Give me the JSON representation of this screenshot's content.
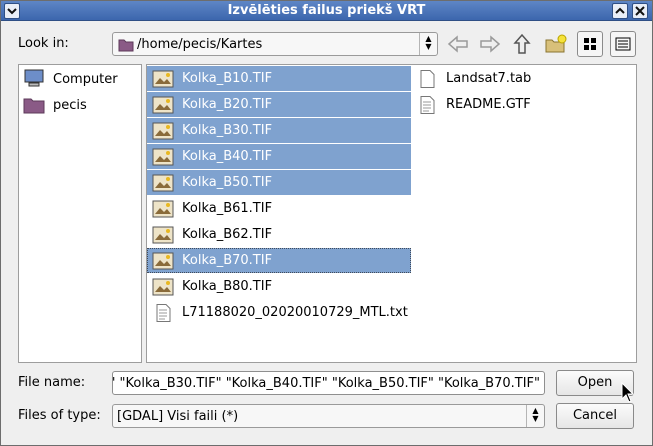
{
  "window": {
    "title": "Izvēlēties failus priekš VRT"
  },
  "toolbar": {
    "look_in_label": "Look in:",
    "current_path": "/home/pecis/Kartes"
  },
  "sidebar": {
    "items": [
      {
        "label": "Computer",
        "icon": "computer-icon"
      },
      {
        "label": "pecis",
        "icon": "folder-icon"
      }
    ]
  },
  "files": {
    "items": [
      {
        "name": "Kolka_B10.TIF",
        "icon": "image-file-icon",
        "selected": true
      },
      {
        "name": "Kolka_B20.TIF",
        "icon": "image-file-icon",
        "selected": true
      },
      {
        "name": "Kolka_B30.TIF",
        "icon": "image-file-icon",
        "selected": true
      },
      {
        "name": "Kolka_B40.TIF",
        "icon": "image-file-icon",
        "selected": true
      },
      {
        "name": "Kolka_B50.TIF",
        "icon": "image-file-icon",
        "selected": true
      },
      {
        "name": "Kolka_B61.TIF",
        "icon": "image-file-icon",
        "selected": false
      },
      {
        "name": "Kolka_B62.TIF",
        "icon": "image-file-icon",
        "selected": false
      },
      {
        "name": "Kolka_B70.TIF",
        "icon": "image-file-icon",
        "selected": true
      },
      {
        "name": "Kolka_B80.TIF",
        "icon": "image-file-icon",
        "selected": false
      },
      {
        "name": "L71188020_02020010729_MTL.txt",
        "icon": "text-file-icon",
        "selected": false
      },
      {
        "name": "Landsat7.tab",
        "icon": "document-file-icon",
        "selected": false
      },
      {
        "name": "README.GTF",
        "icon": "text-file-icon",
        "selected": false
      }
    ]
  },
  "bottom": {
    "file_name_label": "File name:",
    "file_name_value": "\" \"Kolka_B30.TIF\" \"Kolka_B40.TIF\" \"Kolka_B50.TIF\" \"Kolka_B70.TIF\"",
    "files_of_type_label": "Files of type:",
    "files_of_type_value": "[GDAL] Visi faili (*)",
    "open_label": "Open",
    "cancel_label": "Cancel"
  },
  "colors": {
    "selection": "#7fa2cf",
    "titlebar": "#4a74b8"
  }
}
